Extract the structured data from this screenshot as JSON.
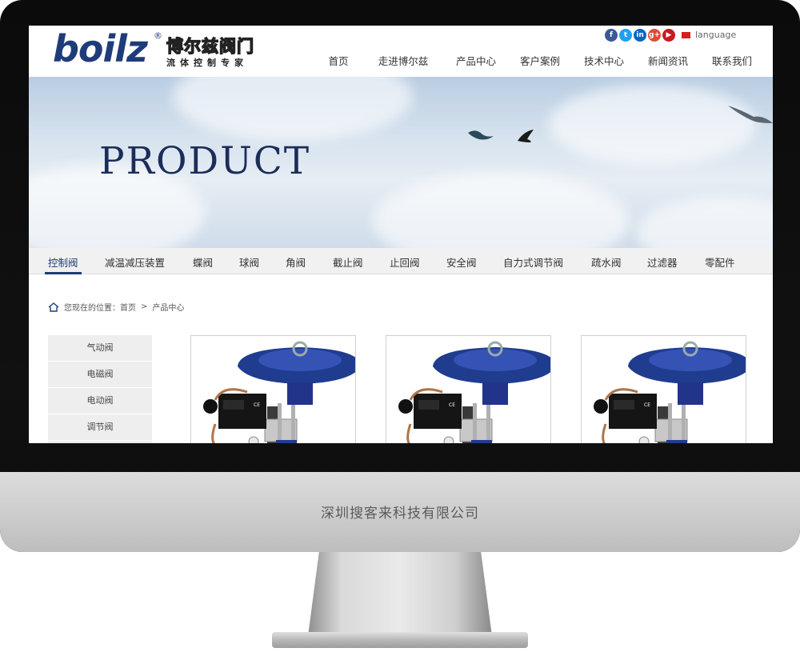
{
  "header": {
    "logo_text": "boilz",
    "logo_registered": "®",
    "logo_cn": "博尔兹阀门",
    "logo_tagline": "流体控制专家",
    "social": [
      {
        "icon": "facebook-icon",
        "glyph": "f",
        "color": "#3b5998"
      },
      {
        "icon": "twitter-icon",
        "glyph": "t",
        "color": "#1da1f2"
      },
      {
        "icon": "linkedin-icon",
        "glyph": "in",
        "color": "#0a66c2"
      },
      {
        "icon": "google-plus-icon",
        "glyph": "g+",
        "color": "#dd4b39"
      },
      {
        "icon": "youtube-icon",
        "glyph": "▶",
        "color": "#cc181e"
      }
    ],
    "language_label": "language",
    "nav": [
      "首页",
      "走进博尔兹",
      "产品中心",
      "客户案例",
      "技术中心",
      "新闻资讯",
      "联系我们"
    ]
  },
  "banner": {
    "title": "PRODUCT"
  },
  "categories": {
    "active_index": 0,
    "items": [
      "控制阀",
      "减温减压装置",
      "蝶阀",
      "球阀",
      "角阀",
      "截止阀",
      "止回阀",
      "安全阀",
      "自力式调节阀",
      "疏水阀",
      "过滤器",
      "零配件"
    ]
  },
  "breadcrumb": {
    "prefix": "您现在的位置：",
    "home": "首页",
    "separator": ">",
    "current": "产品中心"
  },
  "sidebar": {
    "items": [
      "气动阀",
      "电磁阀",
      "电动阀",
      "调节阀"
    ]
  },
  "products": {
    "count_visible": 3,
    "image_icon": "pneumatic-control-valve-image"
  },
  "monitor": {
    "caption": "深圳搜客来科技有限公司"
  },
  "colors": {
    "brand": "#1f3c7a",
    "valve_blue": "#1f3c8f",
    "banner_sky": "#d6e2ee"
  }
}
